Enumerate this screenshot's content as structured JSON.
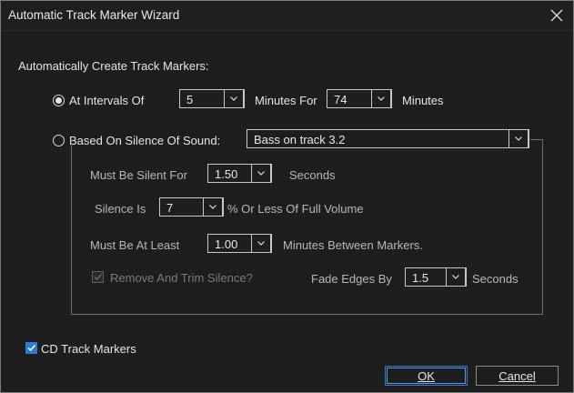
{
  "window": {
    "title": "Automatic Track Marker Wizard"
  },
  "group_label": "Automatically Create Track Markers:",
  "intervals": {
    "label": "At Intervals Of",
    "selected": true,
    "interval_value": "5",
    "minutes_for_label": "Minutes For",
    "total_value": "74",
    "minutes_label": "Minutes"
  },
  "silence": {
    "label": "Based On Silence Of Sound:",
    "selected": false,
    "source_value": "Bass on track 3.2",
    "must_be_silent_label": "Must Be Silent For",
    "silent_value": "1.50",
    "seconds_label": "Seconds",
    "silence_is_label": "Silence Is",
    "silence_value": "7",
    "percent_label": "% Or Less Of Full Volume",
    "at_least_label": "Must Be At Least",
    "at_least_value": "1.00",
    "between_label": "Minutes Between Markers.",
    "remove_trim_label": "Remove And Trim Silence?",
    "remove_trim_checked": true,
    "fade_label": "Fade Edges By",
    "fade_value": "1.5",
    "fade_seconds_label": "Seconds"
  },
  "cd_markers": {
    "label": "CD Track Markers",
    "checked": true
  },
  "buttons": {
    "ok": "OK",
    "cancel": "Cancel"
  },
  "colors": {
    "accent": "#2a7bd6",
    "background": "#1e1e1e",
    "text": "#e6e6e6"
  },
  "icons": {
    "close": "close-icon",
    "dropdown": "chevron-down-icon",
    "check": "checkmark-icon"
  }
}
